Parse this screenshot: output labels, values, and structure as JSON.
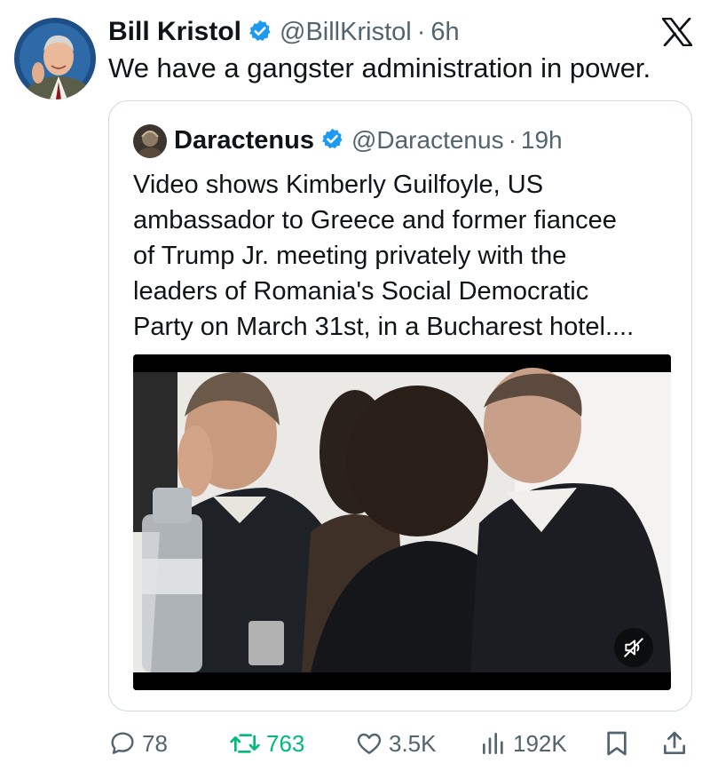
{
  "author": {
    "name": "Bill Kristol",
    "handle": "@BillKristol",
    "separator": "·",
    "time": "6h",
    "verified_icon": "verified-badge-icon"
  },
  "tweet": {
    "text": "We have a gangster administration in power."
  },
  "quoted": {
    "name": "Daractenus",
    "handle": "@Daractenus",
    "separator": "·",
    "time": "19h",
    "text_lines": [
      "Video shows Kimberly Guilfoyle, US",
      "ambassador to Greece and former fiancee",
      "of Trump Jr. meeting privately with the",
      "leaders of Romania's Social Democratic",
      "Party on March 31st, in a Bucharest hotel...."
    ],
    "media": {
      "type": "video",
      "muted_icon": "muted-speaker-icon"
    }
  },
  "actions": {
    "replies": "78",
    "reposts": "763",
    "likes": "3.5K",
    "views": "192K"
  },
  "colors": {
    "verified": "#1d9bf0",
    "text": "#0f1419",
    "muted": "#536471",
    "repost": "#00ba7c",
    "border": "#cfd9de"
  }
}
